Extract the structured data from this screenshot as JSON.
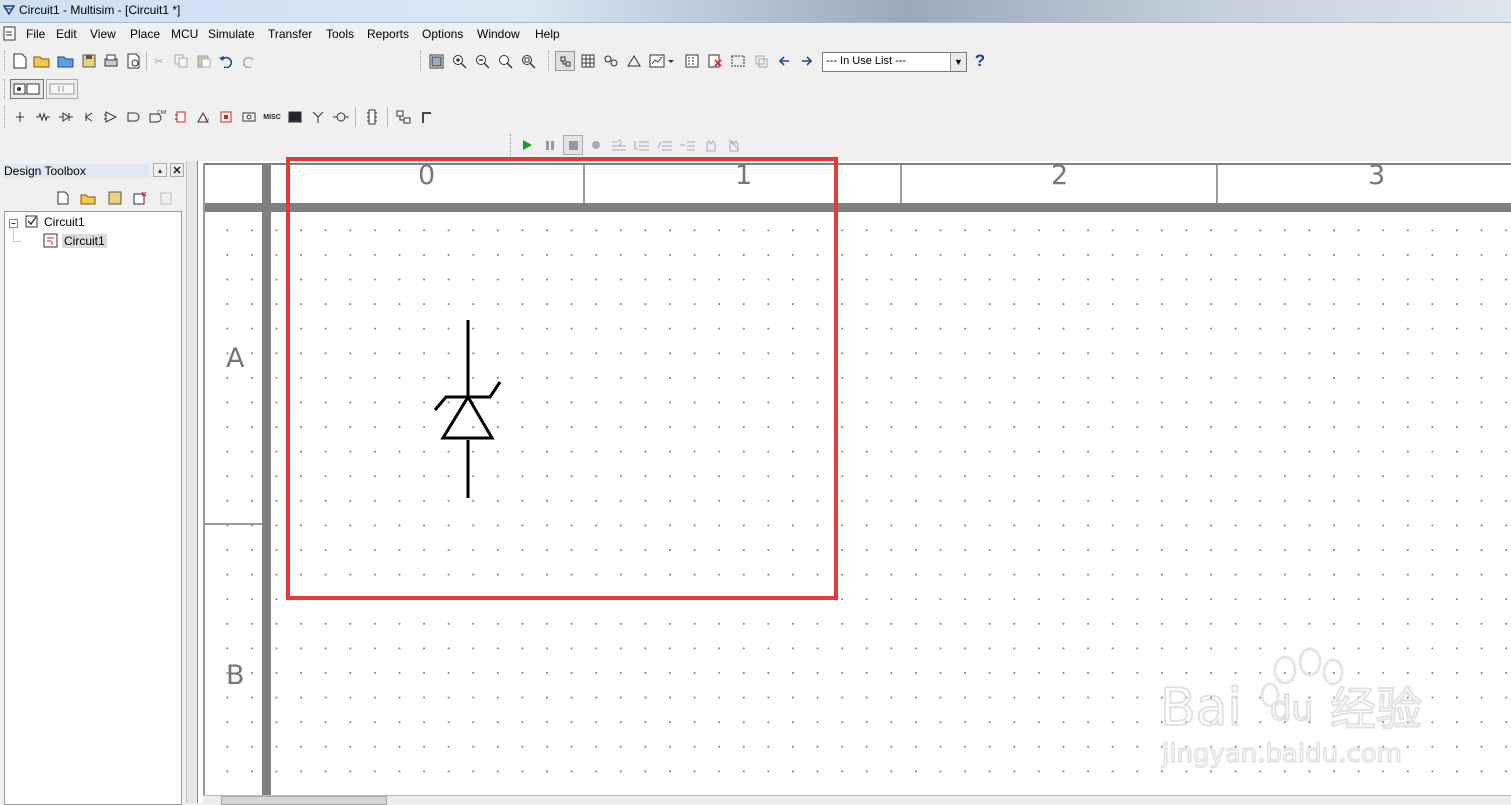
{
  "window": {
    "title": "Circuit1 - Multisim - [Circuit1 *]"
  },
  "menu": {
    "items": [
      {
        "label": "File"
      },
      {
        "label": "Edit"
      },
      {
        "label": "View"
      },
      {
        "label": "Place"
      },
      {
        "label": "MCU"
      },
      {
        "label": "Simulate"
      },
      {
        "label": "Transfer"
      },
      {
        "label": "Tools"
      },
      {
        "label": "Reports"
      },
      {
        "label": "Options"
      },
      {
        "label": "Window"
      },
      {
        "label": "Help"
      }
    ]
  },
  "toolbar": {
    "in_use_list": "--- In Use List ---",
    "help_glyph": "?",
    "misc_label": "MISC"
  },
  "toolbox": {
    "title": "Design Toolbox",
    "tree": {
      "root": "Circuit1",
      "child": "Circuit1"
    }
  },
  "schematic": {
    "columns": [
      "0",
      "1",
      "2",
      "3"
    ],
    "rows": [
      "A",
      "B"
    ],
    "component": "zener-diode"
  },
  "watermark": {
    "brand": "Bai",
    "brand_du": "du",
    "brand_cn": "经验",
    "url": "jingyan.baidu.com"
  },
  "colors": {
    "highlight": "#e43a3a",
    "run": "#1a9c2a"
  }
}
